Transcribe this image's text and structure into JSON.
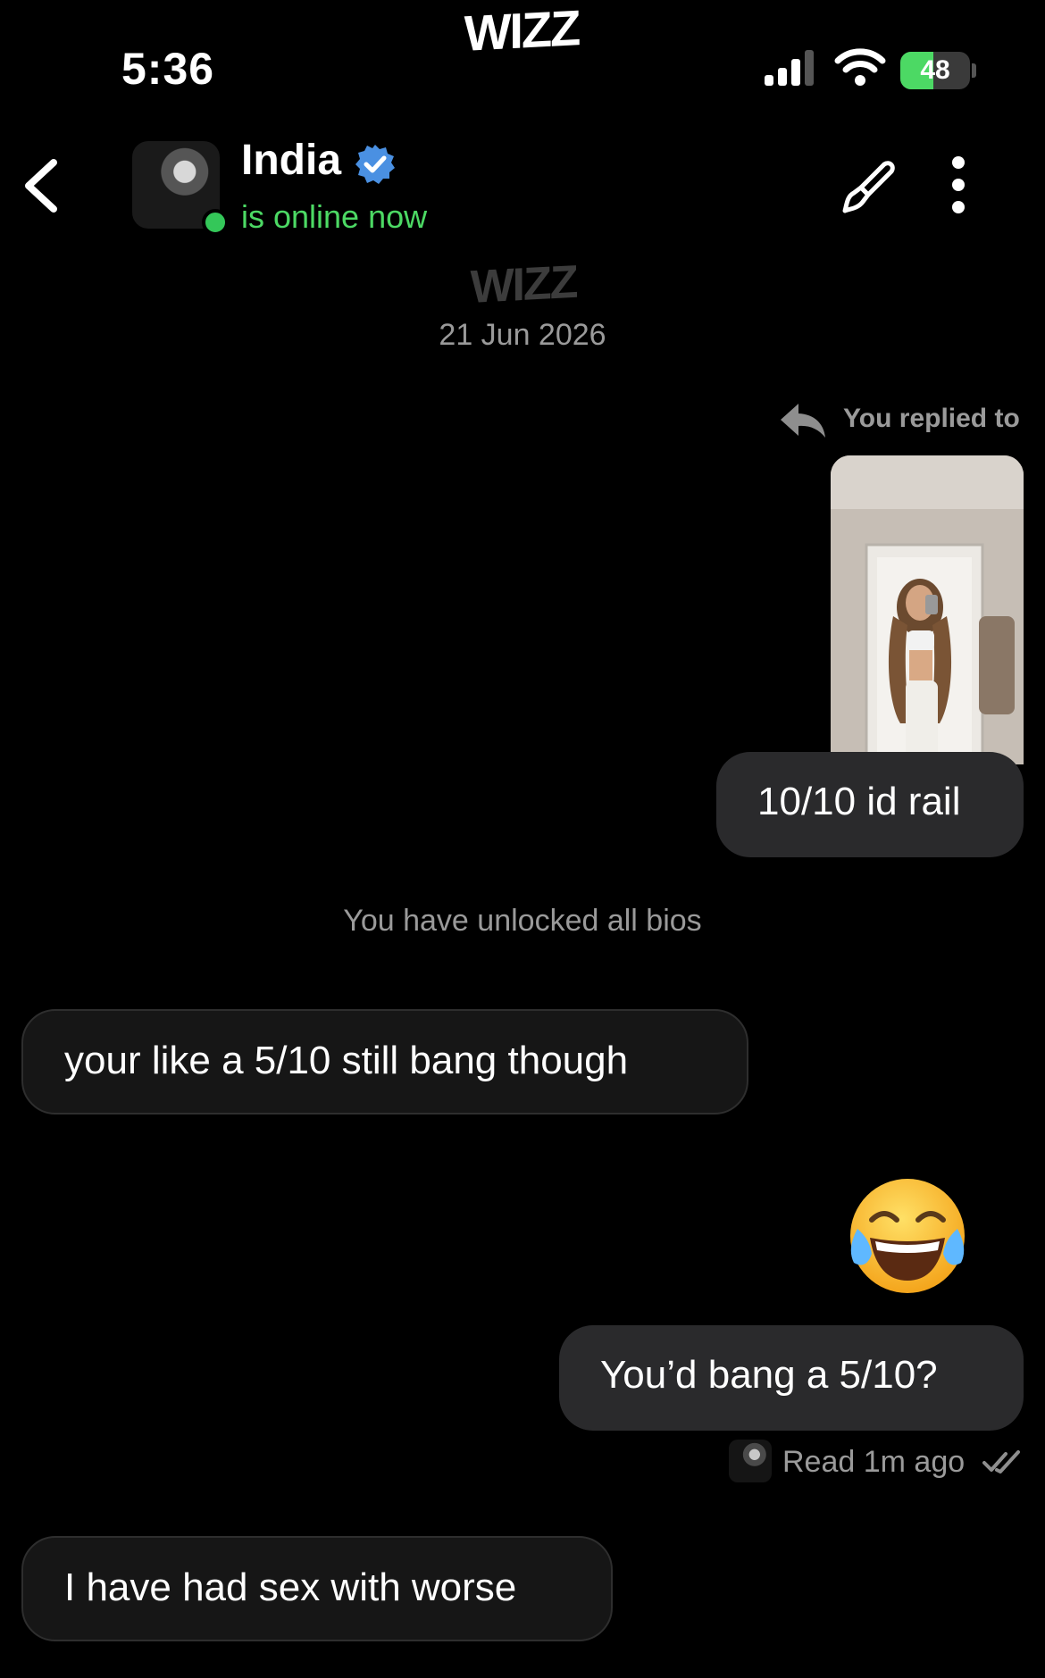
{
  "status_bar": {
    "time": "5:36",
    "battery": "48",
    "battery_level": 0.48
  },
  "brand": {
    "top_logo": "WIZZ",
    "chat_logo": "WIZZ"
  },
  "header": {
    "name": "India",
    "presence": "is online now"
  },
  "chat": {
    "date": "21 Jun 2026",
    "reply": {
      "label": "You replied to"
    },
    "messages": [
      {
        "from": "me",
        "text": "10/10 id rail"
      },
      {
        "from": "system",
        "text": "You have unlocked all bios"
      },
      {
        "from": "them",
        "text": "your like a 5/10 still bang though"
      },
      {
        "from": "me",
        "text": "😂"
      },
      {
        "from": "me",
        "text": "You’d bang a 5/10?"
      },
      {
        "from": "them",
        "text": "I have had sex with worse"
      }
    ],
    "read_receipt": "Read 1m ago"
  },
  "colors": {
    "background": "#000000",
    "online": "#4cd964",
    "verified": "#4a90e2",
    "bubble_out": "#2a2a2c",
    "bubble_in": "#161616",
    "muted_text": "#9a9a9a"
  },
  "icons": [
    "back-icon",
    "verified-badge-icon",
    "paintbrush-icon",
    "more-vertical-icon",
    "reply-arrow-icon",
    "double-check-icon",
    "signal-icon",
    "wifi-icon",
    "battery-icon"
  ]
}
